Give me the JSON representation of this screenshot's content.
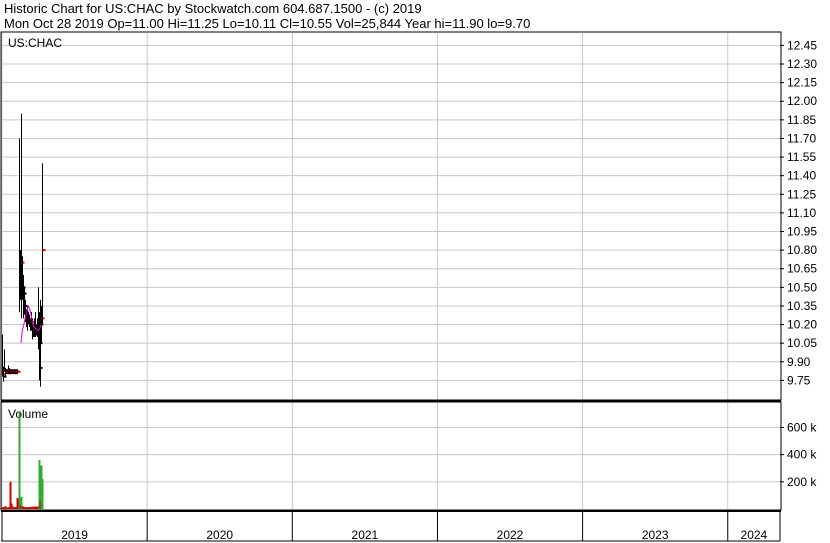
{
  "header": {
    "line1": "Historic Chart for US:CHAC by Stockwatch.com 604.687.1500 - (c) 2019",
    "line2": "Mon Oct 28 2019   Op=11.00  Hi=11.25  Lo=10.11  Cl=10.55  Vol=25,844  Year hi=11.90  lo=9.70"
  },
  "colors": {
    "up": "#d40000",
    "down": "#000000",
    "ma": "#cc00cc",
    "vol_up": "#33aa33",
    "vol_down": "#cc0000",
    "grid": "#c8c8c8"
  },
  "chart_data": {
    "type": "line",
    "price_panel": {
      "label": "US:CHAC",
      "ylim": [
        9.6,
        12.55
      ],
      "yticks": [
        "12.45",
        "12.30",
        "12.15",
        "12.00",
        "11.85",
        "11.70",
        "11.55",
        "11.40",
        "11.25",
        "11.10",
        "10.95",
        "10.80",
        "10.65",
        "10.50",
        "10.35",
        "10.20",
        "10.05",
        "9.90",
        "9.75"
      ],
      "bars": [
        {
          "x": 2019.0,
          "hi": 10.12,
          "lo": 9.78,
          "c": 9.8
        },
        {
          "x": 2019.005,
          "hi": 9.86,
          "lo": 9.74,
          "c": 9.78
        },
        {
          "x": 2019.01,
          "hi": 9.86,
          "lo": 9.78,
          "c": 9.83
        },
        {
          "x": 2019.016,
          "hi": 10.0,
          "lo": 9.82,
          "c": 9.83
        },
        {
          "x": 2019.022,
          "hi": 9.85,
          "lo": 9.78,
          "c": 9.82
        },
        {
          "x": 2019.028,
          "hi": 9.84,
          "lo": 9.8,
          "c": 9.82
        },
        {
          "x": 2019.034,
          "hi": 9.84,
          "lo": 9.8,
          "c": 9.82
        },
        {
          "x": 2019.04,
          "hi": 9.87,
          "lo": 9.8,
          "c": 9.83
        },
        {
          "x": 2019.046,
          "hi": 9.85,
          "lo": 9.8,
          "c": 9.83
        },
        {
          "x": 2019.052,
          "hi": 9.84,
          "lo": 9.8,
          "c": 9.82
        },
        {
          "x": 2019.058,
          "hi": 9.84,
          "lo": 9.8,
          "c": 9.82
        },
        {
          "x": 2019.064,
          "hi": 9.84,
          "lo": 9.8,
          "c": 9.82
        },
        {
          "x": 2019.07,
          "hi": 9.84,
          "lo": 9.8,
          "c": 9.82
        },
        {
          "x": 2019.076,
          "hi": 9.84,
          "lo": 9.8,
          "c": 9.82
        },
        {
          "x": 2019.082,
          "hi": 9.84,
          "lo": 9.8,
          "c": 9.82
        },
        {
          "x": 2019.088,
          "hi": 9.84,
          "lo": 9.8,
          "c": 9.82
        },
        {
          "x": 2019.094,
          "hi": 9.84,
          "lo": 9.8,
          "c": 9.82
        },
        {
          "x": 2019.1,
          "hi": 9.84,
          "lo": 9.8,
          "c": 9.82
        },
        {
          "x": 2019.12,
          "hi": 11.7,
          "lo": 10.3,
          "c": 10.6
        },
        {
          "x": 2019.126,
          "hi": 10.8,
          "lo": 10.4,
          "c": 10.55
        },
        {
          "x": 2019.132,
          "hi": 11.9,
          "lo": 10.25,
          "c": 10.7
        },
        {
          "x": 2019.138,
          "hi": 10.75,
          "lo": 10.4,
          "c": 10.5
        },
        {
          "x": 2019.144,
          "hi": 10.6,
          "lo": 10.25,
          "c": 10.45
        },
        {
          "x": 2019.15,
          "hi": 10.5,
          "lo": 10.28,
          "c": 10.35
        },
        {
          "x": 2019.156,
          "hi": 10.4,
          "lo": 10.22,
          "c": 10.3
        },
        {
          "x": 2019.162,
          "hi": 10.3,
          "lo": 10.2,
          "c": 10.25
        },
        {
          "x": 2019.168,
          "hi": 10.32,
          "lo": 10.18,
          "c": 10.26
        },
        {
          "x": 2019.174,
          "hi": 10.35,
          "lo": 10.15,
          "c": 10.22
        },
        {
          "x": 2019.18,
          "hi": 10.3,
          "lo": 10.2,
          "c": 10.24
        },
        {
          "x": 2019.186,
          "hi": 10.28,
          "lo": 10.18,
          "c": 10.22
        },
        {
          "x": 2019.192,
          "hi": 10.25,
          "lo": 10.15,
          "c": 10.2
        },
        {
          "x": 2019.198,
          "hi": 10.3,
          "lo": 10.15,
          "c": 10.22
        },
        {
          "x": 2019.204,
          "hi": 10.25,
          "lo": 10.1,
          "c": 10.15
        },
        {
          "x": 2019.21,
          "hi": 10.2,
          "lo": 10.08,
          "c": 10.12
        },
        {
          "x": 2019.216,
          "hi": 10.2,
          "lo": 10.1,
          "c": 10.15
        },
        {
          "x": 2019.222,
          "hi": 10.25,
          "lo": 10.1,
          "c": 10.18
        },
        {
          "x": 2019.228,
          "hi": 10.3,
          "lo": 10.1,
          "c": 10.12
        },
        {
          "x": 2019.234,
          "hi": 10.2,
          "lo": 10.12,
          "c": 10.16
        },
        {
          "x": 2019.24,
          "hi": 10.25,
          "lo": 10.1,
          "c": 10.14
        },
        {
          "x": 2019.246,
          "hi": 10.5,
          "lo": 10.0,
          "c": 10.1
        },
        {
          "x": 2019.252,
          "hi": 10.3,
          "lo": 9.95,
          "c": 10.05
        },
        {
          "x": 2019.258,
          "hi": 10.2,
          "lo": 9.75,
          "c": 9.85
        },
        {
          "x": 2019.264,
          "hi": 10.4,
          "lo": 9.7,
          "c": 10.2
        },
        {
          "x": 2019.27,
          "hi": 10.35,
          "lo": 10.05,
          "c": 10.25
        },
        {
          "x": 2019.276,
          "hi": 11.5,
          "lo": 10.2,
          "c": 10.8
        }
      ],
      "moving_average": [
        {
          "x": 2019.13,
          "y": 10.05
        },
        {
          "x": 2019.14,
          "y": 10.15
        },
        {
          "x": 2019.15,
          "y": 10.2
        },
        {
          "x": 2019.16,
          "y": 10.25
        },
        {
          "x": 2019.17,
          "y": 10.3
        },
        {
          "x": 2019.18,
          "y": 10.35
        },
        {
          "x": 2019.19,
          "y": 10.33
        },
        {
          "x": 2019.2,
          "y": 10.28
        },
        {
          "x": 2019.21,
          "y": 10.22
        },
        {
          "x": 2019.22,
          "y": 10.18
        },
        {
          "x": 2019.23,
          "y": 10.17
        },
        {
          "x": 2019.24,
          "y": 10.16
        },
        {
          "x": 2019.25,
          "y": 10.15
        },
        {
          "x": 2019.26,
          "y": 10.17
        },
        {
          "x": 2019.27,
          "y": 10.2
        }
      ]
    },
    "volume_panel": {
      "label": "Volume",
      "ylim": [
        0,
        780000
      ],
      "yticks": [
        {
          "v": 600000,
          "label": "600 k"
        },
        {
          "v": 400000,
          "label": "400 k"
        },
        {
          "v": 200000,
          "label": "200 k"
        }
      ],
      "bars": [
        {
          "x": 2019.0,
          "v": 10000,
          "up": false
        },
        {
          "x": 2019.006,
          "v": 15000,
          "up": false
        },
        {
          "x": 2019.012,
          "v": 12000,
          "up": false
        },
        {
          "x": 2019.018,
          "v": 20000,
          "up": false
        },
        {
          "x": 2019.024,
          "v": 12000,
          "up": false
        },
        {
          "x": 2019.03,
          "v": 10000,
          "up": false
        },
        {
          "x": 2019.04,
          "v": 12000,
          "up": false
        },
        {
          "x": 2019.05,
          "v": 15000,
          "up": false
        },
        {
          "x": 2019.058,
          "v": 200000,
          "up": false
        },
        {
          "x": 2019.064,
          "v": 40000,
          "up": false
        },
        {
          "x": 2019.07,
          "v": 20000,
          "up": false
        },
        {
          "x": 2019.08,
          "v": 12000,
          "up": false
        },
        {
          "x": 2019.09,
          "v": 15000,
          "up": false
        },
        {
          "x": 2019.1,
          "v": 80000,
          "up": false
        },
        {
          "x": 2019.12,
          "v": 720000,
          "up": true
        },
        {
          "x": 2019.126,
          "v": 30000,
          "up": false
        },
        {
          "x": 2019.132,
          "v": 90000,
          "up": true
        },
        {
          "x": 2019.14,
          "v": 20000,
          "up": false
        },
        {
          "x": 2019.15,
          "v": 15000,
          "up": false
        },
        {
          "x": 2019.16,
          "v": 12000,
          "up": false
        },
        {
          "x": 2019.17,
          "v": 15000,
          "up": false
        },
        {
          "x": 2019.18,
          "v": 12000,
          "up": false
        },
        {
          "x": 2019.19,
          "v": 15000,
          "up": false
        },
        {
          "x": 2019.2,
          "v": 12000,
          "up": false
        },
        {
          "x": 2019.21,
          "v": 18000,
          "up": false
        },
        {
          "x": 2019.22,
          "v": 15000,
          "up": false
        },
        {
          "x": 2019.23,
          "v": 20000,
          "up": false
        },
        {
          "x": 2019.24,
          "v": 15000,
          "up": false
        },
        {
          "x": 2019.246,
          "v": 20000,
          "up": false
        },
        {
          "x": 2019.252,
          "v": 120000,
          "up": false
        },
        {
          "x": 2019.258,
          "v": 360000,
          "up": true
        },
        {
          "x": 2019.264,
          "v": 60000,
          "up": false
        },
        {
          "x": 2019.27,
          "v": 320000,
          "up": true
        },
        {
          "x": 2019.276,
          "v": 220000,
          "up": true
        }
      ]
    },
    "xlim": [
      2019.0,
      2024.36
    ],
    "xticks": [
      {
        "x": 2019.0,
        "label": "2019"
      },
      {
        "x": 2020.0,
        "label": "2020"
      },
      {
        "x": 2021.0,
        "label": "2021"
      },
      {
        "x": 2022.0,
        "label": "2022"
      },
      {
        "x": 2023.0,
        "label": "2023"
      },
      {
        "x": 2024.0,
        "label": "2024"
      }
    ],
    "grid": true
  }
}
